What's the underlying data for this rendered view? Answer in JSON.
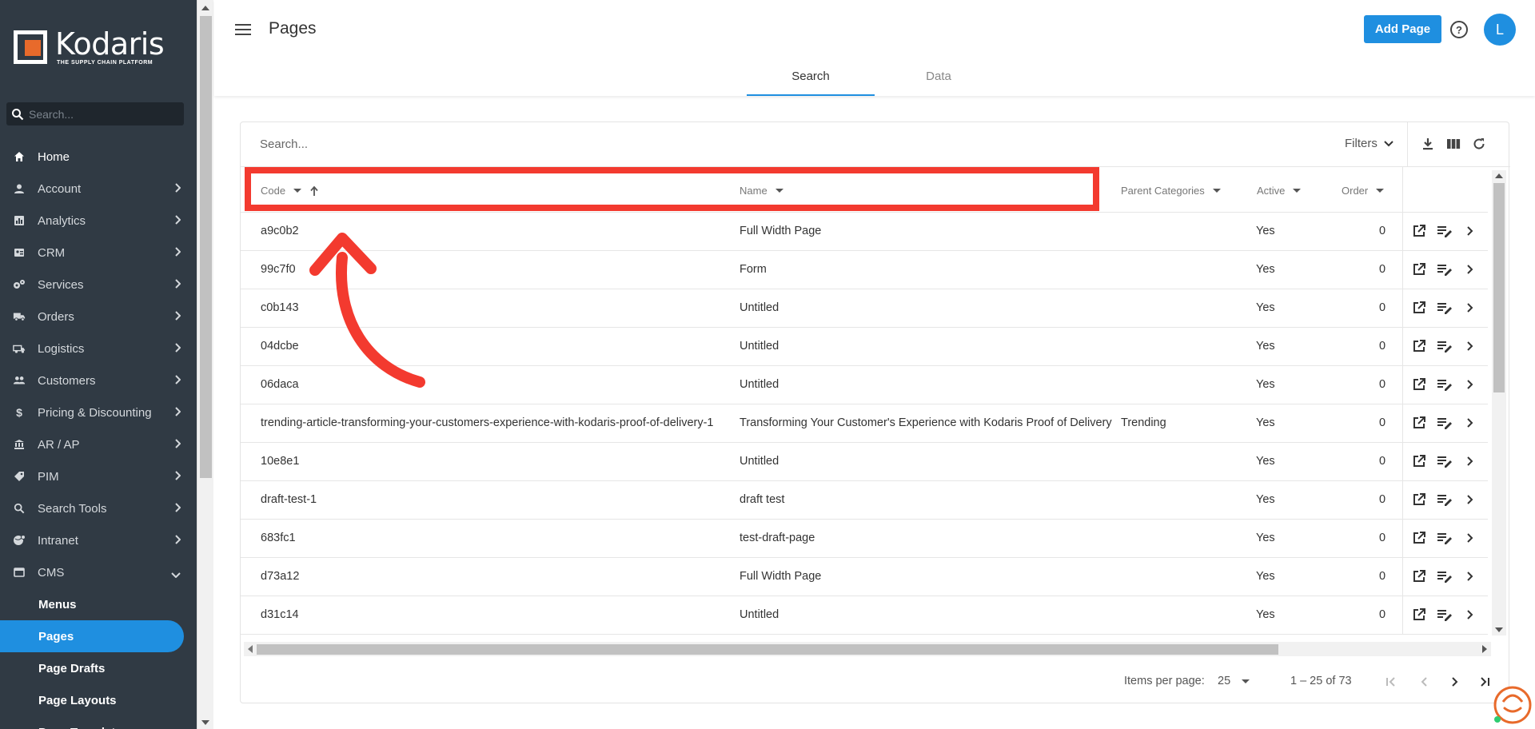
{
  "app": {
    "brand": "Kodaris",
    "tagline": "THE SUPPLY CHAIN PLATFORM",
    "accent_color": "#1f8fe0",
    "sidebar_color": "#303a44",
    "annotation_color": "#f33a2f"
  },
  "sidebar": {
    "search_placeholder": "Search...",
    "items": [
      {
        "label": "Home",
        "icon": "home-icon"
      },
      {
        "label": "Account",
        "icon": "account-icon"
      },
      {
        "label": "Analytics",
        "icon": "analytics-icon"
      },
      {
        "label": "CRM",
        "icon": "crm-icon"
      },
      {
        "label": "Services",
        "icon": "services-icon"
      },
      {
        "label": "Orders",
        "icon": "truck-icon"
      },
      {
        "label": "Logistics",
        "icon": "logistics-icon"
      },
      {
        "label": "Customers",
        "icon": "customers-icon"
      },
      {
        "label": "Pricing & Discounting",
        "icon": "dollar-icon"
      },
      {
        "label": "AR / AP",
        "icon": "bank-icon"
      },
      {
        "label": "PIM",
        "icon": "tag-icon"
      },
      {
        "label": "Search Tools",
        "icon": "search-icon"
      },
      {
        "label": "Intranet",
        "icon": "intranet-icon"
      },
      {
        "label": "CMS",
        "icon": "cms-icon"
      }
    ],
    "cms_children": [
      "Menus",
      "Pages",
      "Page Drafts",
      "Page Layouts",
      "Page Templates"
    ],
    "active_child": "Pages"
  },
  "header": {
    "title": "Pages",
    "add_button": "Add Page",
    "help": "?",
    "avatar_initial": "L",
    "tabs": [
      "Search",
      "Data"
    ],
    "active_tab": "Search"
  },
  "table": {
    "search_placeholder": "Search...",
    "filters_label": "Filters",
    "columns": [
      "Code",
      "Name",
      "Parent Categories",
      "Active",
      "Order"
    ],
    "sort": {
      "column": "Code",
      "direction": "ascending"
    },
    "rows": [
      {
        "code": "a9c0b2",
        "name": "Full Width Page",
        "parent": "",
        "active": "Yes",
        "order": "0"
      },
      {
        "code": "99c7f0",
        "name": "Form",
        "parent": "",
        "active": "Yes",
        "order": "0"
      },
      {
        "code": "c0b143",
        "name": "Untitled",
        "parent": "",
        "active": "Yes",
        "order": "0"
      },
      {
        "code": "04dcbe",
        "name": "Untitled",
        "parent": "",
        "active": "Yes",
        "order": "0"
      },
      {
        "code": "06daca",
        "name": "Untitled",
        "parent": "",
        "active": "Yes",
        "order": "0"
      },
      {
        "code": "trending-article-transforming-your-customers-experience-with-kodaris-proof-of-delivery-1",
        "name": "Transforming Your Customer's Experience with Kodaris Proof of Delivery",
        "parent": "Trending",
        "active": "Yes",
        "order": "0"
      },
      {
        "code": "10e8e1",
        "name": "Untitled",
        "parent": "",
        "active": "Yes",
        "order": "0"
      },
      {
        "code": "draft-test-1",
        "name": "draft test",
        "parent": "",
        "active": "Yes",
        "order": "0"
      },
      {
        "code": "683fc1",
        "name": "test-draft-page",
        "parent": "",
        "active": "Yes",
        "order": "0"
      },
      {
        "code": "d73a12",
        "name": "Full Width Page",
        "parent": "",
        "active": "Yes",
        "order": "0"
      },
      {
        "code": "d31c14",
        "name": "Untitled",
        "parent": "",
        "active": "Yes",
        "order": "0"
      }
    ],
    "row_actions": [
      "open-external-icon",
      "edit-icon",
      "chevron-right-icon"
    ],
    "toolbar_icons": [
      "download-icon",
      "columns-icon",
      "refresh-icon"
    ]
  },
  "pagination": {
    "items_per_page_label": "Items per page:",
    "items_per_page": "25",
    "range": "1 – 25 of 73"
  }
}
